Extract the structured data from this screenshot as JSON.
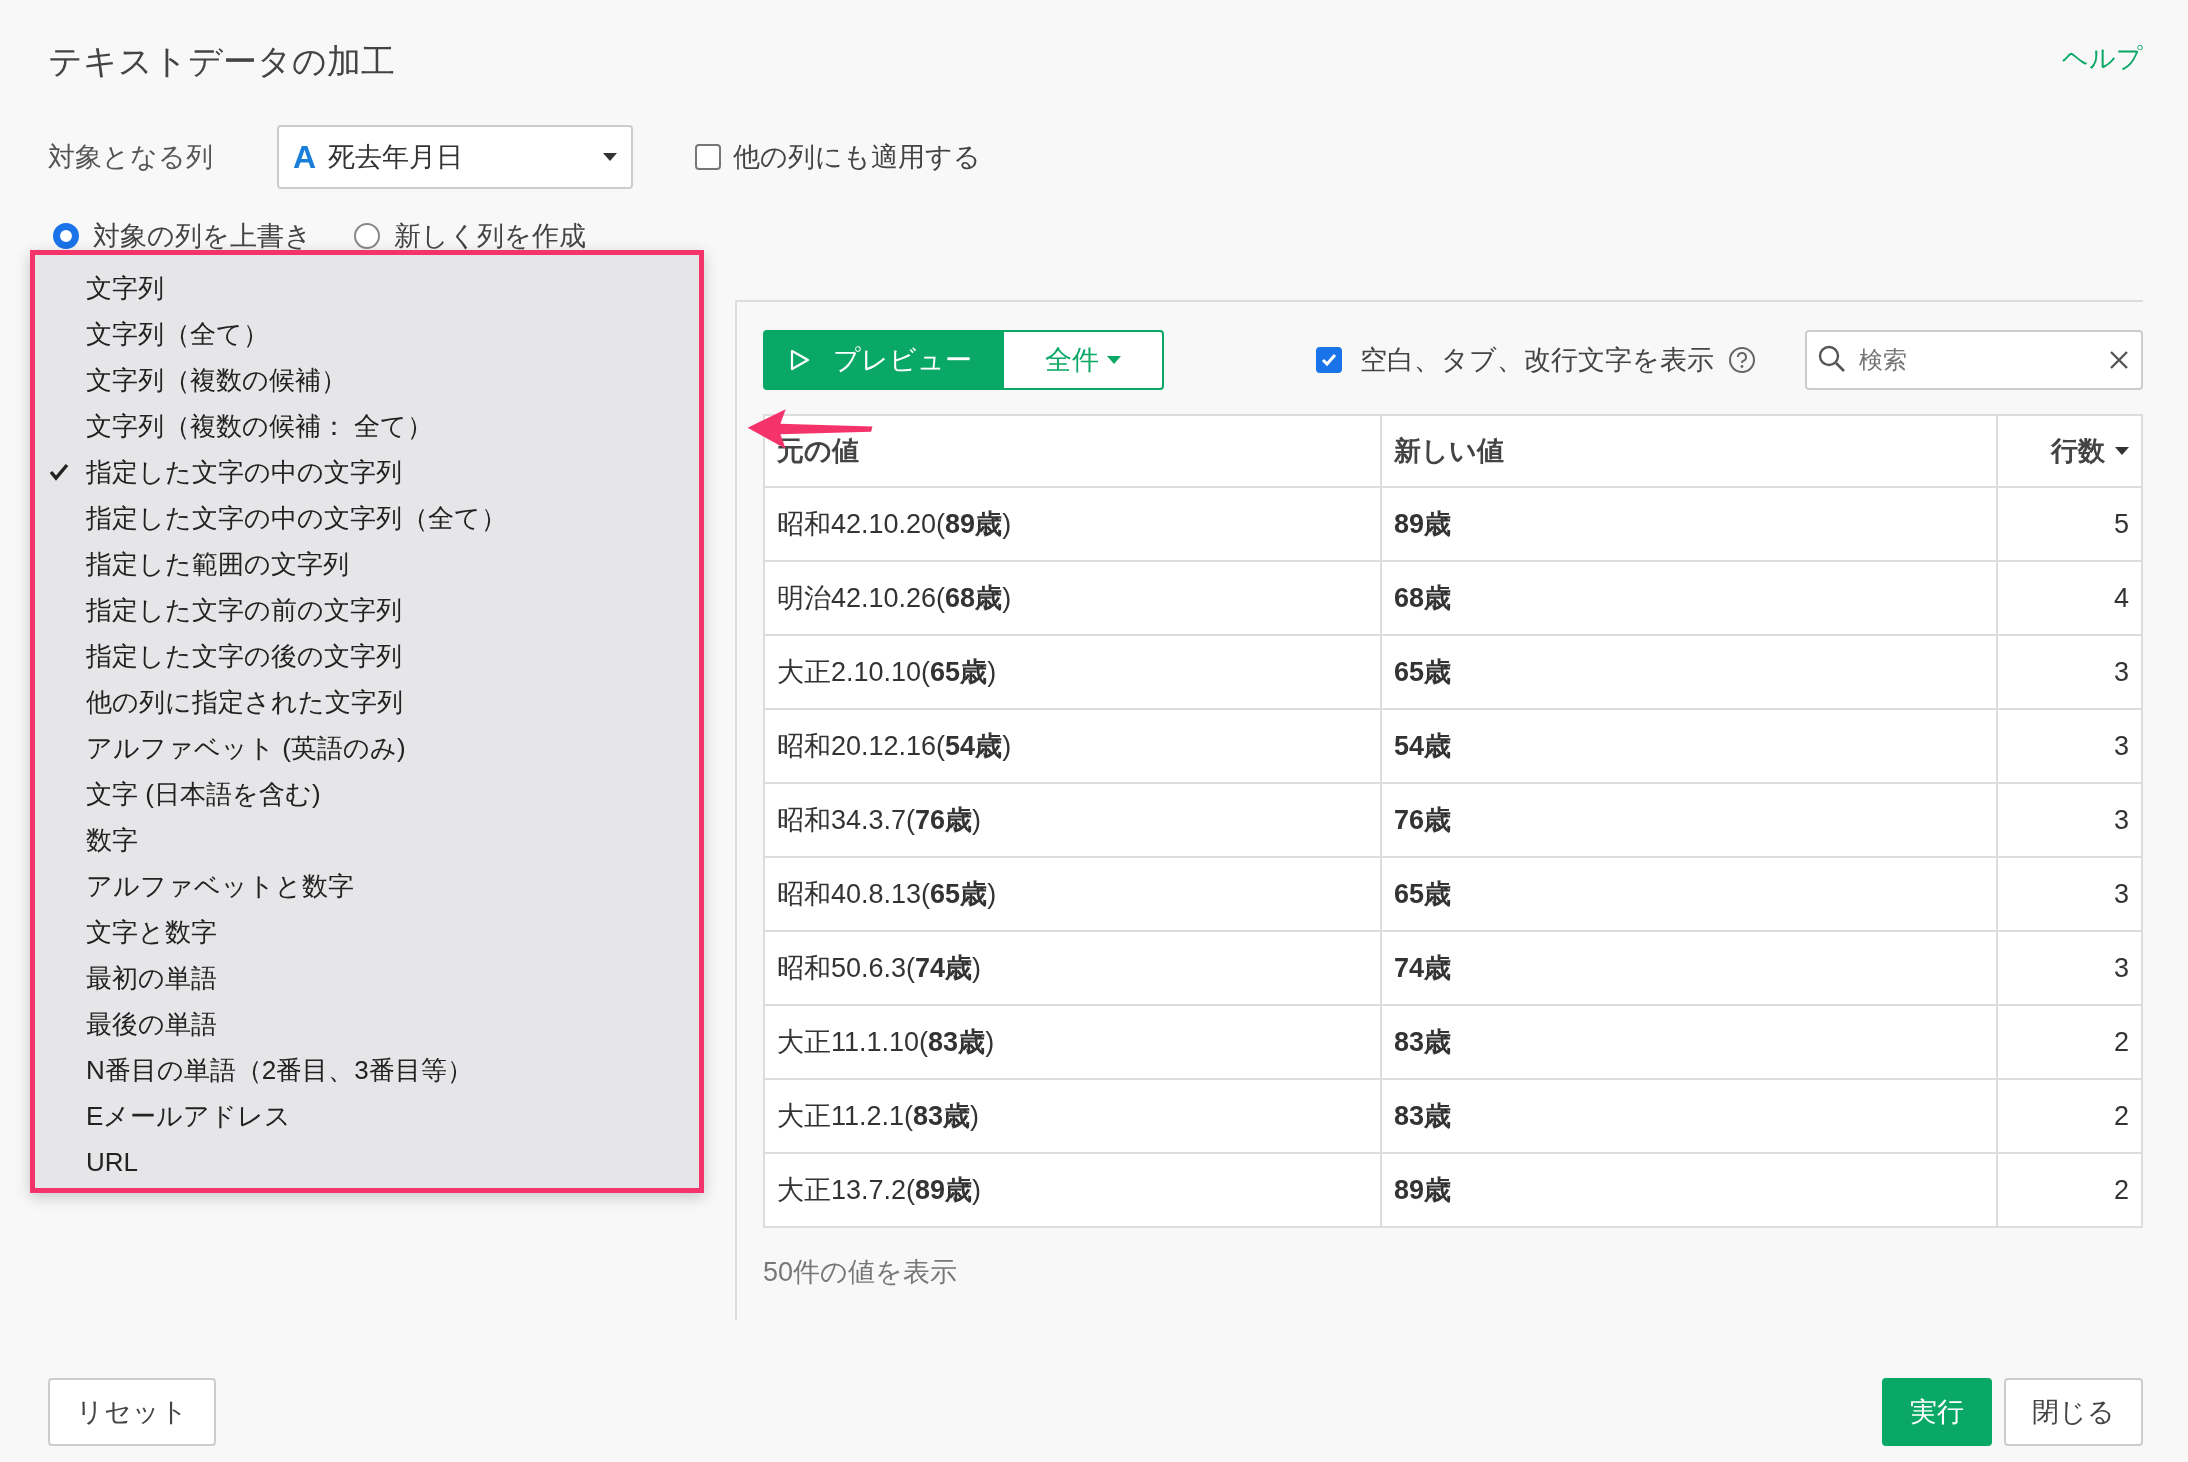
{
  "title": "テキストデータの加工",
  "help": "ヘルプ",
  "target": {
    "label": "対象となる列",
    "column": {
      "type_icon": "A",
      "value": "死去年月日"
    },
    "apply_others": {
      "label": "他の列にも適用する",
      "checked": false
    }
  },
  "output_mode": [
    {
      "label": "対象の列を上書き",
      "selected": true
    },
    {
      "label": "新しく列を作成",
      "selected": false
    }
  ],
  "menu": {
    "items": [
      {
        "label": "文字列",
        "checked": false
      },
      {
        "label": "文字列（全て）",
        "checked": false
      },
      {
        "label": "文字列（複数の候補）",
        "checked": false
      },
      {
        "label": "文字列（複数の候補： 全て）",
        "checked": false
      },
      {
        "label": "指定した文字の中の文字列",
        "checked": true
      },
      {
        "label": "指定した文字の中の文字列（全て）",
        "checked": false
      },
      {
        "label": "指定した範囲の文字列",
        "checked": false
      },
      {
        "label": "指定した文字の前の文字列",
        "checked": false
      },
      {
        "label": "指定した文字の後の文字列",
        "checked": false
      },
      {
        "label": "他の列に指定された文字列",
        "checked": false
      },
      {
        "label": "アルファベット (英語のみ)",
        "checked": false
      },
      {
        "label": "文字 (日本語を含む)",
        "checked": false
      },
      {
        "label": "数字",
        "checked": false
      },
      {
        "label": "アルファベットと数字",
        "checked": false
      },
      {
        "label": "文字と数字",
        "checked": false
      },
      {
        "label": "最初の単語",
        "checked": false
      },
      {
        "label": "最後の単語",
        "checked": false
      },
      {
        "label": "N番目の単語（2番目、3番目等）",
        "checked": false
      },
      {
        "label": "Eメールアドレス",
        "checked": false
      },
      {
        "label": "URL",
        "checked": false
      }
    ]
  },
  "toolbar": {
    "preview": "プレビュー",
    "scope": "全件",
    "show_whitespace": {
      "label": "空白、タブ、改行文字を表示",
      "checked": true
    },
    "search": {
      "placeholder": "検索"
    }
  },
  "table": {
    "columns": [
      {
        "label": "元の値",
        "sorted": false
      },
      {
        "label": "新しい値",
        "sorted": false
      },
      {
        "label": "行数",
        "sorted": true
      }
    ],
    "rows": [
      {
        "original": "昭和42.10.20(**89歳**)",
        "new": "89歳",
        "count": "5"
      },
      {
        "original": "明治42.10.26(**68歳**)",
        "new": "68歳",
        "count": "4"
      },
      {
        "original": "大正2.10.10(**65歳**)",
        "new": "65歳",
        "count": "3"
      },
      {
        "original": "昭和20.12.16(**54歳**)",
        "new": "54歳",
        "count": "3"
      },
      {
        "original": "昭和34.3.7(**76歳**)",
        "new": "76歳",
        "count": "3"
      },
      {
        "original": "昭和40.8.13(**65歳**)",
        "new": "65歳",
        "count": "3"
      },
      {
        "original": "昭和50.6.3(**74歳**)",
        "new": "74歳",
        "count": "3"
      },
      {
        "original": "大正11.1.10(**83歳**)",
        "new": "83歳",
        "count": "2"
      },
      {
        "original": "大正11.2.1(**83歳**)",
        "new": "83歳",
        "count": "2"
      },
      {
        "original": "大正13.7.2(**89歳**)",
        "new": "89歳",
        "count": "2"
      }
    ]
  },
  "footer": "50件の値を表示",
  "buttons": {
    "reset": "リセット",
    "run": "実行",
    "close": "閉じる"
  }
}
